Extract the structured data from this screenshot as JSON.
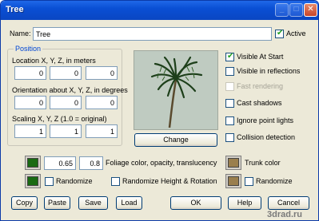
{
  "window": {
    "title": "Tree",
    "colors": {
      "titlebar": "#0a4fd4",
      "face": "#ece9d8",
      "group_title": "#0046d5"
    }
  },
  "titlebar_buttons": {
    "minimize": "_",
    "maximize": "□",
    "close": "✕"
  },
  "name": {
    "label": "Name:",
    "value": "Tree",
    "active_label": "Active",
    "active_checked": true
  },
  "position": {
    "group_title": "Position",
    "location_label": "Location X, Y, Z,  in meters",
    "location": [
      "0",
      "0",
      "0"
    ],
    "orientation_label": "Orientation about X, Y, Z, in degrees",
    "orientation": [
      "0",
      "0",
      "0"
    ],
    "scaling_label": "Scaling X, Y, Z (1.0 = original)",
    "scaling": [
      "1",
      "1",
      "1"
    ]
  },
  "preview": {
    "change_label": "Change",
    "background": "#bfcbc1"
  },
  "options": [
    {
      "label": "Visible At Start",
      "checked": true,
      "enabled": true
    },
    {
      "label": "Visible in reflections",
      "checked": false,
      "enabled": true
    },
    {
      "label": "Fast rendering",
      "checked": false,
      "enabled": false
    },
    {
      "label": "Cast shadows",
      "checked": false,
      "enabled": true
    },
    {
      "label": "Ignore point lights",
      "checked": false,
      "enabled": true
    },
    {
      "label": "Collision detection",
      "checked": false,
      "enabled": true
    }
  ],
  "foliage": {
    "color": "#1a6a12",
    "opacity": "0.65",
    "translucency": "0.8",
    "label": "Foliage color, opacity, translucency",
    "randomize_label": "Randomize",
    "randomize_hr_label": "Randomize Height & Rotation"
  },
  "trunk": {
    "color": "#9a7f4e",
    "label": "Trunk color",
    "randomize_label": "Randomize"
  },
  "buttons": {
    "copy": "Copy",
    "paste": "Paste",
    "save": "Save",
    "load": "Load",
    "ok": "OK",
    "help": "Help",
    "cancel": "Cancel"
  },
  "watermark": "3drad.ru"
}
